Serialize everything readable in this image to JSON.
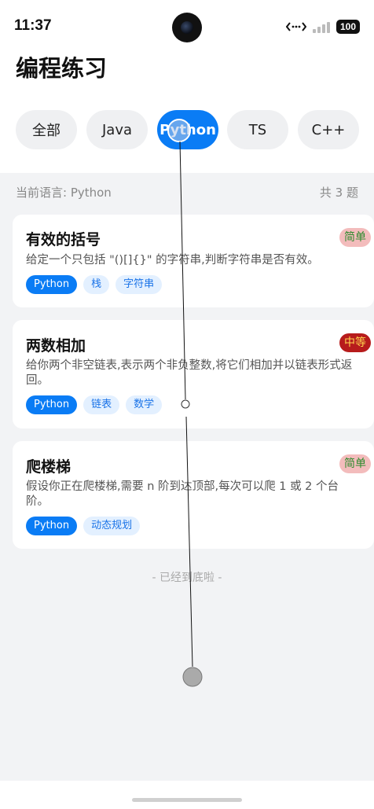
{
  "status_bar": {
    "time": "11:37",
    "battery": "100"
  },
  "page_title": "编程练习",
  "tabs": [
    {
      "label": "全部",
      "active": false
    },
    {
      "label": "Java",
      "active": false
    },
    {
      "label": "Python",
      "active": true
    },
    {
      "label": "TS",
      "active": false
    },
    {
      "label": "C++",
      "active": false
    }
  ],
  "content_header": {
    "language": "当前语言: Python",
    "count": "共 3 题"
  },
  "problems": [
    {
      "title": "有效的括号",
      "difficulty": "简单",
      "description": "给定一个只包括 \"()[]{}\" 的字符串,判断字符串是否有效。",
      "tags": [
        "Python",
        "栈",
        "字符串"
      ]
    },
    {
      "title": "两数相加",
      "difficulty": "中等",
      "description": "给你两个非空链表,表示两个非负整数,将它们相加并以链表形式返回。",
      "tags": [
        "Python",
        "链表",
        "数学"
      ]
    },
    {
      "title": "爬楼梯",
      "difficulty": "简单",
      "description": "假设你正在爬楼梯,需要 n 阶到达顶部,每次可以爬 1 或 2 个台阶。",
      "tags": [
        "Python",
        "动态规划"
      ]
    }
  ],
  "end_text": "- 已经到底啦 -",
  "colors": {
    "accent": "#0a7cf5",
    "easy_bg": "#f3bcbc",
    "medium_bg": "#b71c1c"
  }
}
